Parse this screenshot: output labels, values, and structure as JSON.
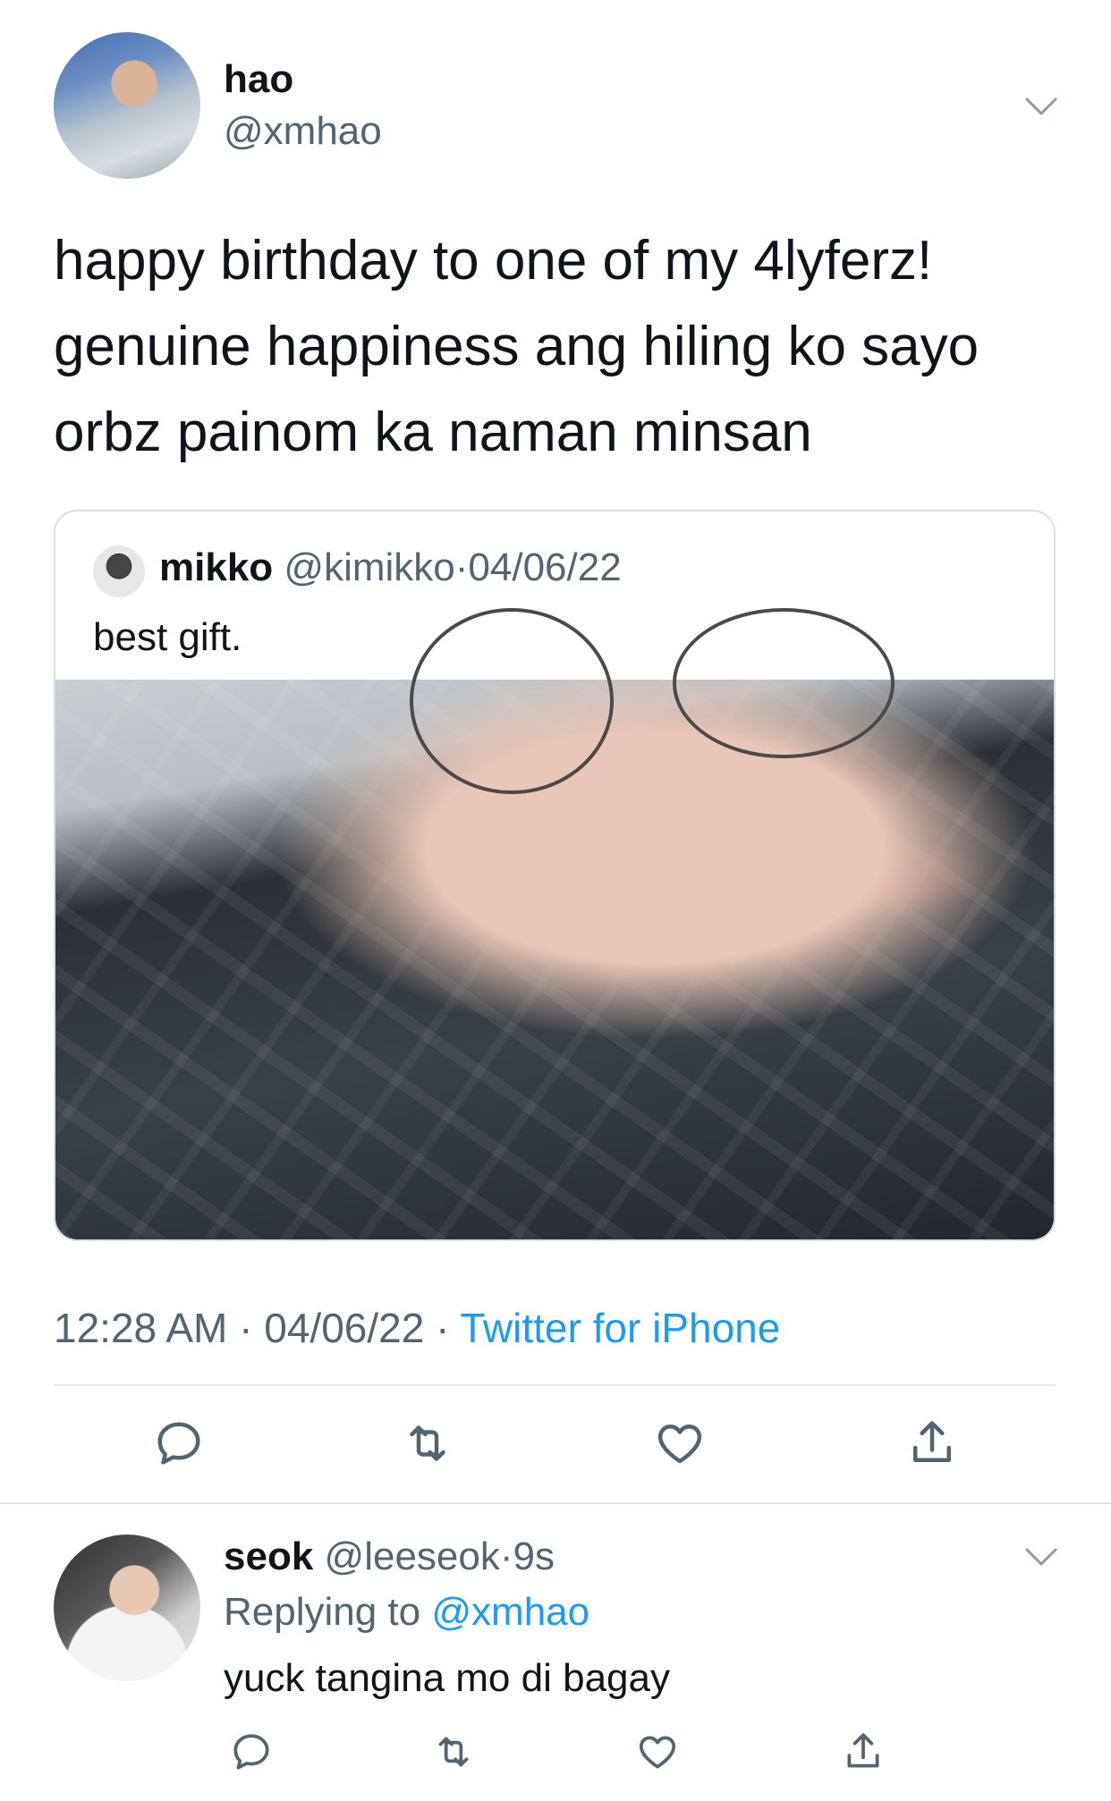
{
  "tweet": {
    "author": {
      "name": "hao",
      "handle": "@xmhao"
    },
    "text_lines": [
      "happy birthday to one of my 4lyferz!",
      "genuine happiness ang hiling ko sayo",
      "orbz painom ka naman minsan"
    ],
    "quote": {
      "name": "mikko",
      "handle": "@kimikko",
      "separator": "·",
      "date": "04/06/22",
      "text": "best gift."
    },
    "meta": {
      "time": "12:28 AM",
      "separator": "·",
      "date": "04/06/22",
      "source": "Twitter for iPhone"
    }
  },
  "reply": {
    "name": "seok",
    "handle": "@leeseok",
    "separator": "·",
    "age": "9s",
    "replying_prefix": "Replying to",
    "replying_to": "@xmhao",
    "text": "yuck tangina mo di bagay"
  },
  "icons": {
    "reply": "reply-icon",
    "retweet": "retweet-icon",
    "like": "heart-icon",
    "share": "share-icon",
    "more": "chevron-down-icon"
  },
  "colors": {
    "link": "#1d9bf0",
    "secondary_text": "#536471",
    "divider": "#e3e6e9"
  }
}
